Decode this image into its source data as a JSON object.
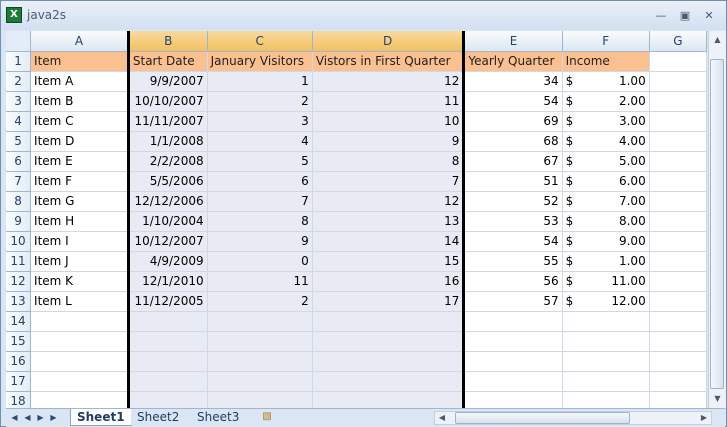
{
  "window": {
    "title": "java2s",
    "app_icon_letter": "X"
  },
  "sheet": {
    "columns": [
      "A",
      "B",
      "C",
      "D",
      "E",
      "F",
      "G"
    ],
    "rows": [
      {
        "n": "1",
        "cells": [
          "Item",
          "Start Date",
          "January Visitors",
          "Vistors in First Quarter",
          "Yearly Quarter",
          "",
          "",
          ""
        ]
      },
      {
        "n": "2",
        "cells": [
          "Item A",
          "9/9/2007",
          "1",
          "12",
          "34",
          "$",
          "1.00",
          ""
        ]
      },
      {
        "n": "3",
        "cells": [
          "Item B",
          "10/10/2007",
          "2",
          "11",
          "54",
          "$",
          "2.00",
          ""
        ]
      },
      {
        "n": "4",
        "cells": [
          "Item C",
          "11/11/2007",
          "3",
          "10",
          "69",
          "$",
          "3.00",
          ""
        ]
      },
      {
        "n": "5",
        "cells": [
          "Item D",
          "1/1/2008",
          "4",
          "9",
          "68",
          "$",
          "4.00",
          ""
        ]
      },
      {
        "n": "6",
        "cells": [
          "Item E",
          "2/2/2008",
          "5",
          "8",
          "67",
          "$",
          "5.00",
          ""
        ]
      },
      {
        "n": "7",
        "cells": [
          "Item F",
          "5/5/2006",
          "6",
          "7",
          "51",
          "$",
          "6.00",
          ""
        ]
      },
      {
        "n": "8",
        "cells": [
          "Item G",
          "12/12/2006",
          "7",
          "12",
          "52",
          "$",
          "7.00",
          ""
        ]
      },
      {
        "n": "9",
        "cells": [
          "Item H",
          "1/10/2004",
          "8",
          "13",
          "53",
          "$",
          "8.00",
          ""
        ]
      },
      {
        "n": "10",
        "cells": [
          "Item I",
          "10/12/2007",
          "9",
          "14",
          "54",
          "$",
          "9.00",
          ""
        ]
      },
      {
        "n": "11",
        "cells": [
          "Item J",
          "4/9/2009",
          "0",
          "15",
          "55",
          "$",
          "1.00",
          ""
        ]
      },
      {
        "n": "12",
        "cells": [
          "Item K",
          "12/1/2010",
          "11",
          "16",
          "56",
          "$",
          "11.00",
          ""
        ]
      },
      {
        "n": "13",
        "cells": [
          "Item L",
          "11/12/2005",
          "2",
          "17",
          "57",
          "$",
          "12.00",
          ""
        ]
      },
      {
        "n": "14",
        "cells": [
          "",
          "",
          "",
          "",
          "",
          "",
          "",
          ""
        ]
      },
      {
        "n": "15",
        "cells": [
          "",
          "",
          "",
          "",
          "",
          "",
          "",
          ""
        ]
      },
      {
        "n": "16",
        "cells": [
          "",
          "",
          "",
          "",
          "",
          "",
          "",
          ""
        ]
      },
      {
        "n": "17",
        "cells": [
          "",
          "",
          "",
          "",
          "",
          "",
          "",
          ""
        ]
      },
      {
        "n": "18",
        "cells": [
          "",
          "",
          "",
          "",
          "",
          "",
          "",
          ""
        ]
      }
    ],
    "income_header": "Income",
    "selected_columns": [
      "B",
      "C",
      "D"
    ],
    "header_fill_color": "#fac090",
    "selection_fill_color": "#e8ebf4"
  },
  "tabs": {
    "sheets": [
      "Sheet1",
      "Sheet2",
      "Sheet3"
    ],
    "active": "Sheet1"
  }
}
